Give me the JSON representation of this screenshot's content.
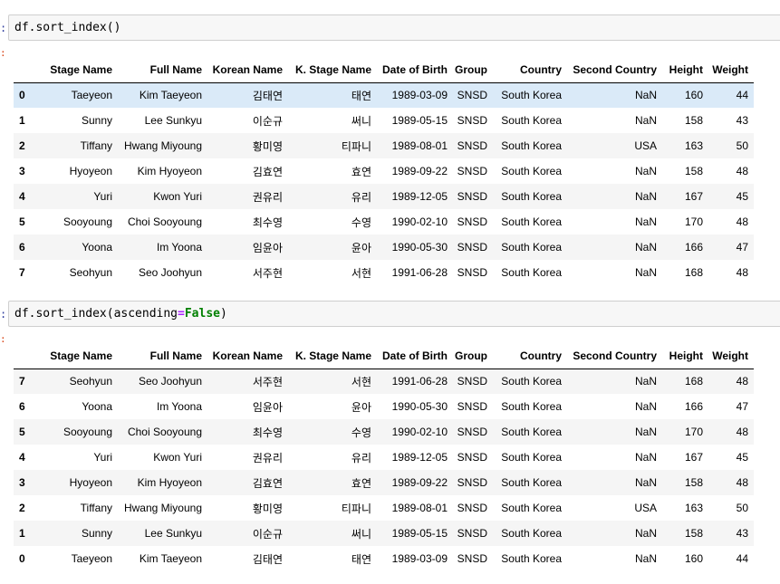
{
  "cell1": {
    "prompt": ":",
    "out_mark": ":",
    "code_prefix": "df.sort_index()",
    "code_op": "",
    "code_const": "",
    "code_suffix": ""
  },
  "cell2": {
    "prompt": ":",
    "out_mark": ":",
    "code_prefix": "df.sort_index(ascending",
    "code_op": "=",
    "code_const": "False",
    "code_suffix": ")"
  },
  "columns": [
    "Stage Name",
    "Full Name",
    "Korean Name",
    "K. Stage Name",
    "Date of Birth",
    "Group",
    "Country",
    "Second Country",
    "Height",
    "Weight"
  ],
  "colors": {
    "highlight_row": "#daeaf8",
    "zebra_row": "#f5f5f5",
    "prompt": "#303f9f",
    "out_prompt": "#d84315",
    "keyword_const": "#008000",
    "operator": "#aa22ff"
  },
  "table1": {
    "rows": [
      {
        "idx": "0",
        "cells": [
          "Taeyeon",
          "Kim Taeyeon",
          "김태연",
          "태연",
          "1989-03-09",
          "SNSD",
          "South Korea",
          "NaN",
          "160",
          "44"
        ]
      },
      {
        "idx": "1",
        "cells": [
          "Sunny",
          "Lee Sunkyu",
          "이순규",
          "써니",
          "1989-05-15",
          "SNSD",
          "South Korea",
          "NaN",
          "158",
          "43"
        ]
      },
      {
        "idx": "2",
        "cells": [
          "Tiffany",
          "Hwang Miyoung",
          "황미영",
          "티파니",
          "1989-08-01",
          "SNSD",
          "South Korea",
          "USA",
          "163",
          "50"
        ]
      },
      {
        "idx": "3",
        "cells": [
          "Hyoyeon",
          "Kim Hyoyeon",
          "김효연",
          "효연",
          "1989-09-22",
          "SNSD",
          "South Korea",
          "NaN",
          "158",
          "48"
        ]
      },
      {
        "idx": "4",
        "cells": [
          "Yuri",
          "Kwon Yuri",
          "권유리",
          "유리",
          "1989-12-05",
          "SNSD",
          "South Korea",
          "NaN",
          "167",
          "45"
        ]
      },
      {
        "idx": "5",
        "cells": [
          "Sooyoung",
          "Choi Sooyoung",
          "최수영",
          "수영",
          "1990-02-10",
          "SNSD",
          "South Korea",
          "NaN",
          "170",
          "48"
        ]
      },
      {
        "idx": "6",
        "cells": [
          "Yoona",
          "Im Yoona",
          "임윤아",
          "윤아",
          "1990-05-30",
          "SNSD",
          "South Korea",
          "NaN",
          "166",
          "47"
        ]
      },
      {
        "idx": "7",
        "cells": [
          "Seohyun",
          "Seo Joohyun",
          "서주현",
          "서현",
          "1991-06-28",
          "SNSD",
          "South Korea",
          "NaN",
          "168",
          "48"
        ]
      }
    ]
  },
  "table2": {
    "rows": [
      {
        "idx": "7",
        "cells": [
          "Seohyun",
          "Seo Joohyun",
          "서주현",
          "서현",
          "1991-06-28",
          "SNSD",
          "South Korea",
          "NaN",
          "168",
          "48"
        ]
      },
      {
        "idx": "6",
        "cells": [
          "Yoona",
          "Im Yoona",
          "임윤아",
          "윤아",
          "1990-05-30",
          "SNSD",
          "South Korea",
          "NaN",
          "166",
          "47"
        ]
      },
      {
        "idx": "5",
        "cells": [
          "Sooyoung",
          "Choi Sooyoung",
          "최수영",
          "수영",
          "1990-02-10",
          "SNSD",
          "South Korea",
          "NaN",
          "170",
          "48"
        ]
      },
      {
        "idx": "4",
        "cells": [
          "Yuri",
          "Kwon Yuri",
          "권유리",
          "유리",
          "1989-12-05",
          "SNSD",
          "South Korea",
          "NaN",
          "167",
          "45"
        ]
      },
      {
        "idx": "3",
        "cells": [
          "Hyoyeon",
          "Kim Hyoyeon",
          "김효연",
          "효연",
          "1989-09-22",
          "SNSD",
          "South Korea",
          "NaN",
          "158",
          "48"
        ]
      },
      {
        "idx": "2",
        "cells": [
          "Tiffany",
          "Hwang Miyoung",
          "황미영",
          "티파니",
          "1989-08-01",
          "SNSD",
          "South Korea",
          "USA",
          "163",
          "50"
        ]
      },
      {
        "idx": "1",
        "cells": [
          "Sunny",
          "Lee Sunkyu",
          "이순규",
          "써니",
          "1989-05-15",
          "SNSD",
          "South Korea",
          "NaN",
          "158",
          "43"
        ]
      },
      {
        "idx": "0",
        "cells": [
          "Taeyeon",
          "Kim Taeyeon",
          "김태연",
          "태연",
          "1989-03-09",
          "SNSD",
          "South Korea",
          "NaN",
          "160",
          "44"
        ]
      }
    ]
  }
}
